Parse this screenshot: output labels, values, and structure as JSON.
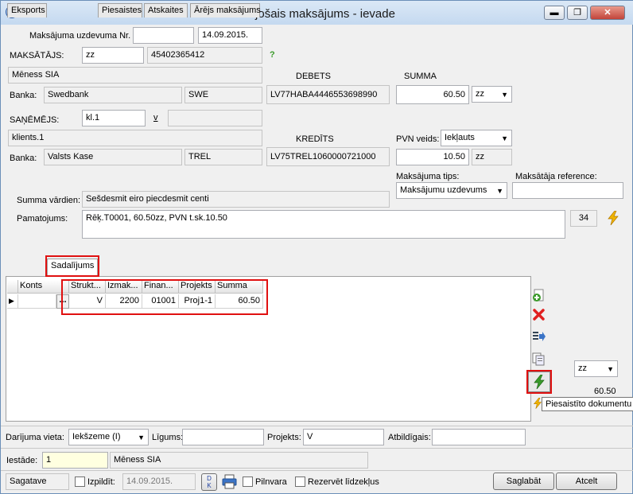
{
  "window": {
    "title": "Izejošais maksājums - ievade",
    "btn_min": "▬",
    "btn_max": "❐",
    "btn_close": "✕"
  },
  "header": {
    "doc_nr_label": "Maksājuma uzdevuma Nr.",
    "doc_nr_value": "",
    "doc_date": "14.09.2015.",
    "payer_label": "MAKSĀTĀJS:",
    "payer_code": "zz",
    "payer_reg": "45402365412",
    "payer_help": "?",
    "payer_name": "Mēness SIA",
    "payer_bank_label": "Banka:",
    "payer_bank": "Swedbank",
    "payer_bank_code": "SWE",
    "debit_label": "DEBETS",
    "debit_account": "LV77HABA4446553698990",
    "sum_label": "SUMMA",
    "sum_value": "60.50",
    "sum_currency": "zz",
    "receiver_label": "SAŅĒMĒJS:",
    "receiver_code": "kl.1",
    "receiver_link": "v",
    "receiver_extra": "",
    "receiver_name": "klients.1",
    "receiver_bank_label": "Banka:",
    "receiver_bank": "Valsts Kase",
    "receiver_bank_code": "TREL",
    "credit_label": "KREDĪTS",
    "credit_account": "LV75TREL1060000721000",
    "vat_label": "PVN veids:",
    "vat_type": "Iekļauts",
    "vat_value": "10.50",
    "vat_currency": "zz",
    "pay_type_label": "Maksājuma tips:",
    "pay_type": "Maksājumu uzdevums",
    "payer_ref_label": "Maksātāja reference:",
    "payer_ref": "",
    "sum_words_label": "Summa vārdien:",
    "sum_words": "Sešdesmit  eiro piecdesmit centi",
    "basis_label": "Pamatojums:",
    "basis_text": "Rēķ.T0001, 60.50zz, PVN t.sk.10.50",
    "basis_count": "34"
  },
  "tabs": [
    {
      "label": "Eksports"
    },
    {
      "label": "Sadalījums"
    },
    {
      "label": "Piesaistes"
    },
    {
      "label": "Atskaites"
    },
    {
      "label": "Ārējs maksājums"
    }
  ],
  "grid": {
    "headers": [
      "Konts",
      "Strukt...",
      "Izmak...",
      "Finan...",
      "Projekts",
      "Summa"
    ],
    "row": {
      "konts": "",
      "ellipsis": "...",
      "strukt": "V",
      "izmak": "2200",
      "finan": "01001",
      "projekts": "Proj1-1",
      "summa": "60.50"
    }
  },
  "side": {
    "currency": "zz",
    "total": "60.50",
    "tooltip": "Piesaistīto dokumentu"
  },
  "bottom": {
    "place_label": "Darījuma vieta:",
    "place_value": "Iekšzeme (I)",
    "contract_label": "Līgums:",
    "contract_value": "",
    "project_label": "Projekts:",
    "project_value": "V",
    "responsible_label": "Atbildīgais:",
    "responsible_value": "",
    "institution_label": "Iestāde:",
    "institution_code": "1",
    "institution_name": "Mēness SIA",
    "status": "Sagatave",
    "executed_label": "Izpildīt:",
    "executed_date": "14.09.2015.",
    "dk_label": "D\nK",
    "proxy_label": "Pilnvara",
    "reserve_label": "Rezervēt līdzekļus",
    "save_label": "Saglabāt",
    "cancel_label": "Atcelt"
  },
  "colors": {
    "accent_red": "#e01010",
    "yellow_bg": "#ffffe0",
    "lightning": "#f0b400",
    "green": "#3a9a2a"
  }
}
